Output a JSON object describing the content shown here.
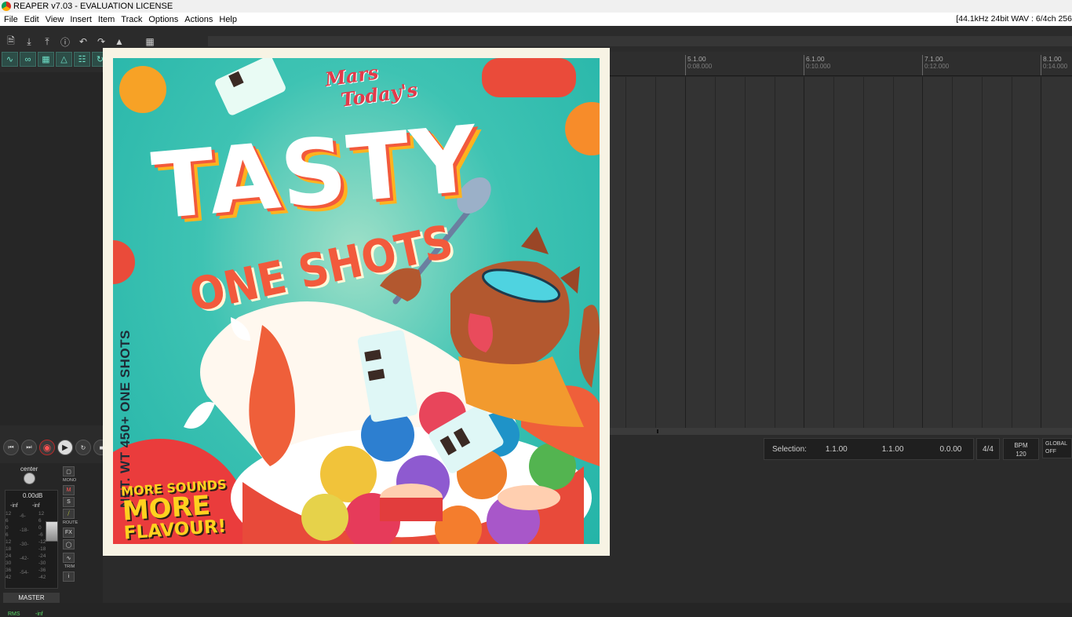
{
  "window": {
    "title": "REAPER v7.03 - EVALUATION LICENSE",
    "status": "[44.1kHz 24bit WAV : 6/4ch 256"
  },
  "menu": [
    "File",
    "Edit",
    "View",
    "Insert",
    "Item",
    "Track",
    "Options",
    "Actions",
    "Help"
  ],
  "ruler": {
    "marks": [
      {
        "label": "5.1.00",
        "time": "0:08.000"
      },
      {
        "label": "6.1.00",
        "time": "0:10.000"
      },
      {
        "label": "7.1.00",
        "time": "0:12.000"
      },
      {
        "label": "8.1.00",
        "time": "0:14.000"
      }
    ]
  },
  "transport": {
    "selection_label": "Selection:",
    "start": "1.1.00",
    "end": "1.1.00",
    "length": "0.0.00",
    "time_signature": "4/4",
    "bpm_label": "BPM",
    "bpm_value": "120",
    "global_label": "GLOBAL",
    "global_value": "OFF"
  },
  "master": {
    "pan": "center",
    "volume": "0.00dB",
    "peak_left": "-inf",
    "peak_right": "-inf",
    "scale_left": "12\n6\n0\n6\n12\n18\n24\n30\n36\n42",
    "scale_mid": "-6-\n\n-18-\n\n-30-\n\n-42-\n\n-54-",
    "scale_right": "12\n6\n0\n-6\n-12\n-18\n-24\n-30\n-36\n-42",
    "rms_label": "RMS",
    "rms_value": "-inf",
    "label": "MASTER",
    "buttons": {
      "mono": "MONO",
      "mute": "M",
      "solo": "S",
      "route": "ROUTE",
      "fx": "FX",
      "trim": "TRIM"
    }
  },
  "cover": {
    "brand_line1": "Mars",
    "brand_line2": "Today's",
    "title": "TASTY",
    "subtitle": "ONE SHOTS",
    "net_weight": "NET. WT  450+ ONE SHOTS",
    "promo_line1": "MORE SOUNDS",
    "promo_line2": "MORE",
    "promo_line3": "FLAVOUR!"
  },
  "colors": {
    "accent_teal": "#3ec3b3",
    "record_red": "#ff5353",
    "title_orange": "#f25a3c"
  }
}
